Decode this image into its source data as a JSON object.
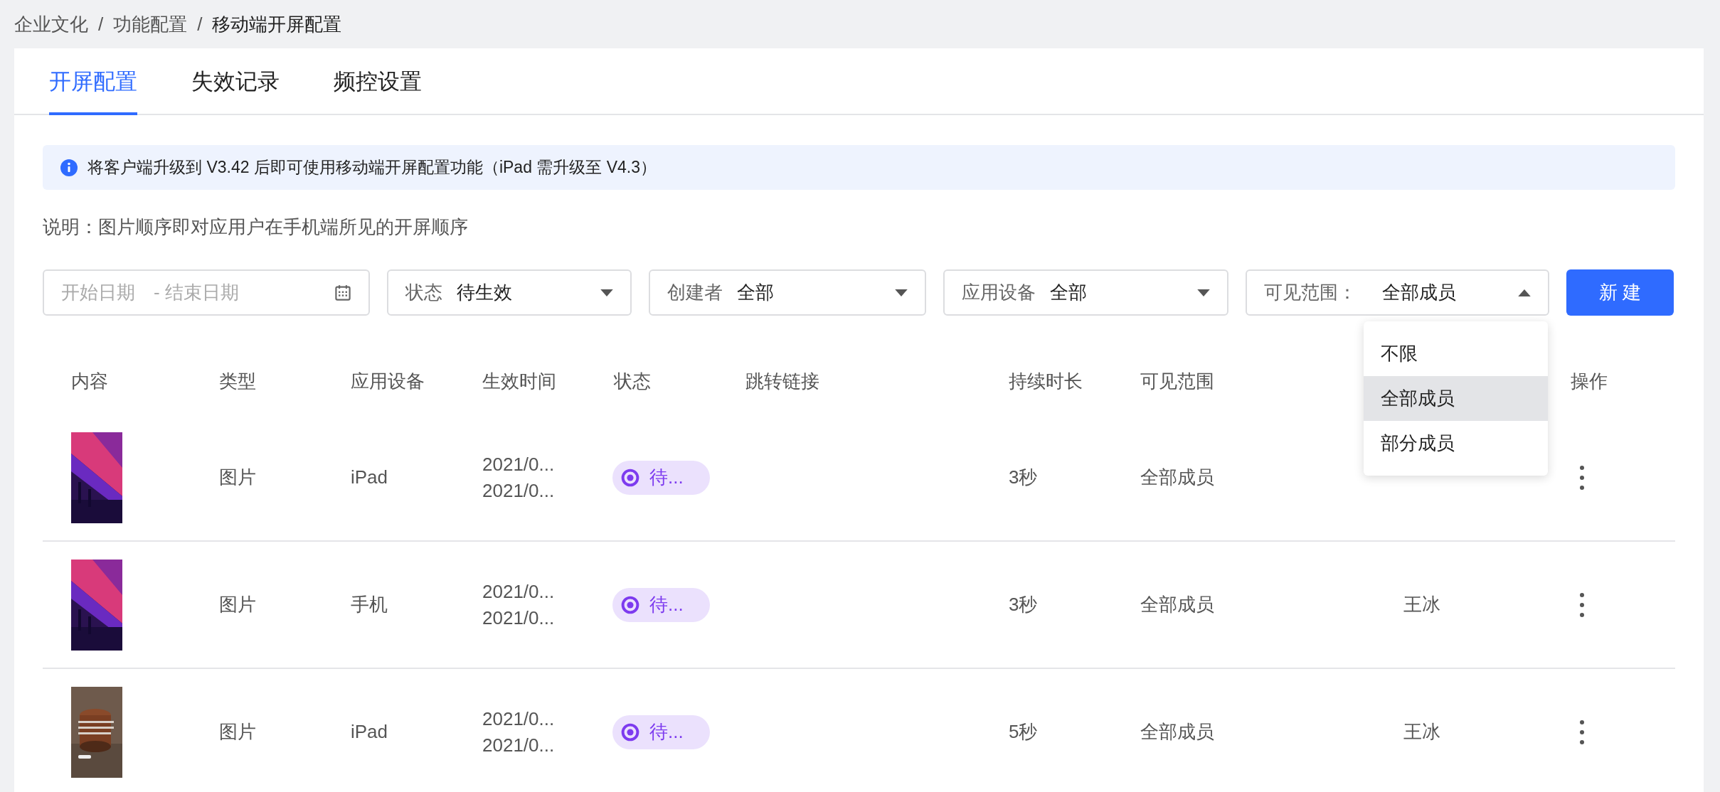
{
  "breadcrumb": [
    {
      "label": "企业文化",
      "current": false
    },
    {
      "label": "功能配置",
      "current": false
    },
    {
      "label": "移动端开屏配置",
      "current": true
    }
  ],
  "breadcrumb_separator": "/",
  "tabs": [
    {
      "label": "开屏配置",
      "selected": true
    },
    {
      "label": "失效记录",
      "selected": false
    },
    {
      "label": "频控设置",
      "selected": false
    }
  ],
  "alert": {
    "text": "将客户端升级到 V3.42 后即可使用移动端开屏配置功能（iPad 需升级至 V4.3）"
  },
  "note": "说明：图片顺序即对应用户在手机端所见的开屏顺序",
  "filters": {
    "date_range": {
      "start_placeholder": "开始日期",
      "separator": "-",
      "end_placeholder": "结束日期"
    },
    "selects": [
      {
        "label": "状态",
        "value": "待生效",
        "expanded": false
      },
      {
        "label": "创建者",
        "value": "全部",
        "expanded": false
      },
      {
        "label": "应用设备",
        "value": "全部",
        "expanded": false
      },
      {
        "label": "可见范围：",
        "value": "全部成员",
        "expanded": true,
        "options": [
          {
            "label": "不限",
            "selected": false
          },
          {
            "label": "全部成员",
            "selected": true
          },
          {
            "label": "部分成员",
            "selected": false
          }
        ]
      }
    ]
  },
  "new_button": "新 建",
  "table": {
    "columns": [
      "内容",
      "类型",
      "应用设备",
      "生效时间",
      "状态",
      "跳转链接",
      "持续时长",
      "可见范围",
      "操作"
    ],
    "rows": [
      {
        "type": "图片",
        "device": "iPad",
        "times": [
          "2021/0...",
          "2021/0..."
        ],
        "status": "待...",
        "duration": "3秒",
        "scope": "全部成员"
      },
      {
        "type": "图片",
        "device": "手机",
        "times": [
          "2021/0...",
          "2021/0..."
        ],
        "status": "待...",
        "duration": "3秒",
        "scope": "全部成员",
        "creator": "王冰"
      },
      {
        "type": "图片",
        "device": "iPad",
        "times": [
          "2021/0...",
          "2021/0..."
        ],
        "status": "待...",
        "duration": "5秒",
        "scope": "全部成员",
        "creator": "王冰"
      }
    ]
  }
}
